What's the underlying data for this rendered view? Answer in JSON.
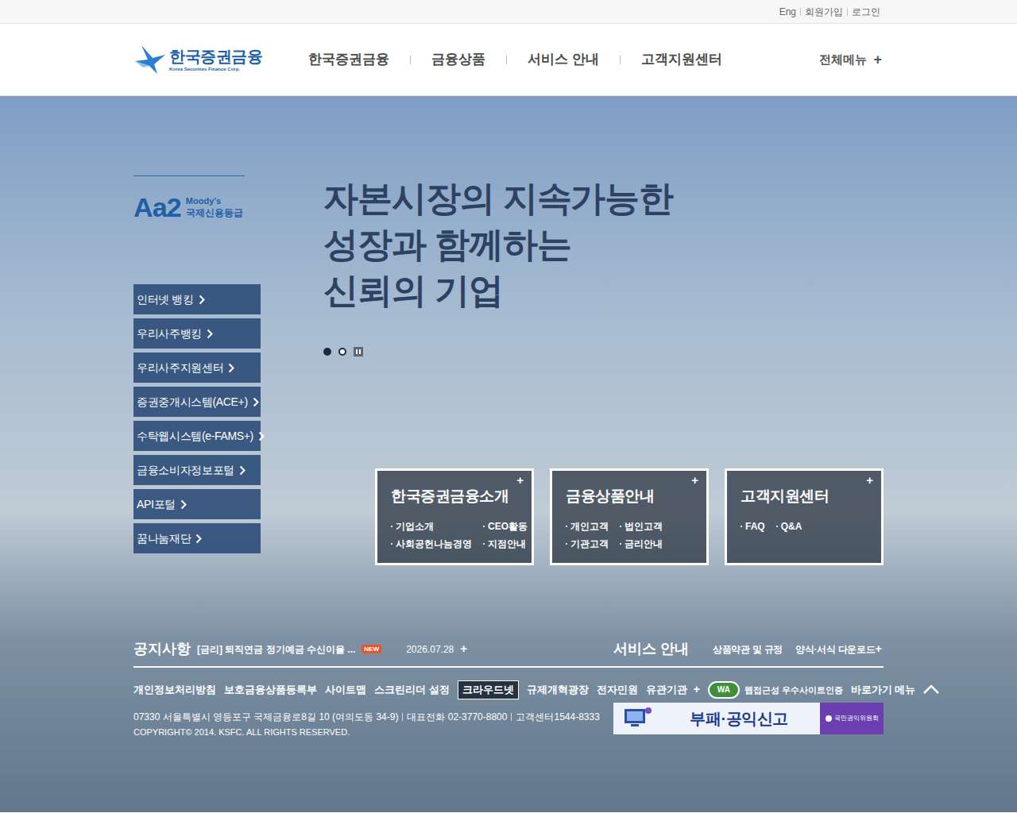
{
  "top_links": [
    "Eng",
    "회원가입",
    "로그인"
  ],
  "logo": {
    "name": "한국증권금융",
    "english": "Korea Securities Finance Corp."
  },
  "nav": [
    "한국증권금융",
    "금융상품",
    "서비스 안내",
    "고객지원센터"
  ],
  "all_menu": {
    "label": "전체메뉴",
    "icon": "+"
  },
  "rating": {
    "grade": "Aa2",
    "agency": "Moody's",
    "label": "국제신용등급"
  },
  "quick_links": [
    {
      "label": "인터넷 뱅킹"
    },
    {
      "label": "우리사주뱅킹"
    },
    {
      "label": "우리사주지원센터"
    },
    {
      "label": "증권중개시스템(ACE+)"
    },
    {
      "label": "수탁웹시스템(e-FAMS+)"
    },
    {
      "label": "금융소비자정보포털"
    },
    {
      "label": "API포털"
    },
    {
      "label": "꿈나눔재단"
    }
  ],
  "hero": {
    "lines": [
      "자본시장의 지속가능한",
      "성장과 함께하는",
      "신뢰의 기업"
    ],
    "slides": [
      {
        "selected": true
      },
      {
        "selected": false
      }
    ]
  },
  "cards": [
    {
      "title": "한국증권금융소개",
      "icon": "+",
      "links": [
        "기업소개",
        "CEO활동",
        "사회공헌나눔경영",
        "지점안내"
      ]
    },
    {
      "title": "금융상품안내",
      "icon": "+",
      "links": [
        "개인고객",
        "법인고객",
        "기관고객",
        "금리안내"
      ]
    },
    {
      "title": "고객지원센터",
      "icon": "+",
      "links": [
        "FAQ",
        "Q&A"
      ]
    }
  ],
  "notice": {
    "label": "공지사항",
    "text": "[금리] 퇴직연금 정기예금 수신이율 ...",
    "badge": "NEW",
    "date": "2026.07.28",
    "more": "+"
  },
  "service": {
    "label": "서비스 안내",
    "links": [
      "상품약관 및 규정",
      "양식·서식 다운로드"
    ],
    "more": "+"
  },
  "footer_links": [
    {
      "label": "개인정보처리방침",
      "kind": "text"
    },
    {
      "label": "보호금융상품등록부",
      "kind": "text"
    },
    {
      "label": "사이트맵",
      "kind": "text"
    },
    {
      "label": "스크린리더 설정",
      "kind": "text"
    },
    {
      "label": "크라우드넷",
      "kind": "boxed"
    },
    {
      "label": "규제개혁광장",
      "kind": "text"
    },
    {
      "label": "전자민원",
      "kind": "text"
    },
    {
      "label": "유관기관",
      "kind": "more",
      "icon": "+"
    },
    {
      "label": "웹접근성 우수사이트인증",
      "kind": "badge",
      "mark": "WA"
    },
    {
      "label": "바로가기 메뉴",
      "kind": "top"
    }
  ],
  "address": "07330 서울특별시 영등포구 국제금융로8길 10 (여의도동 34-9)",
  "phone": "대표전화 02-3770-8800",
  "center": "고객센터1544-8333",
  "copyright": "COPYRIGHT© 2014. KSFC. ALL RIGHTS RESERVED.",
  "banner": {
    "title": "부패·공익신고",
    "org": "국민권익위원회"
  }
}
